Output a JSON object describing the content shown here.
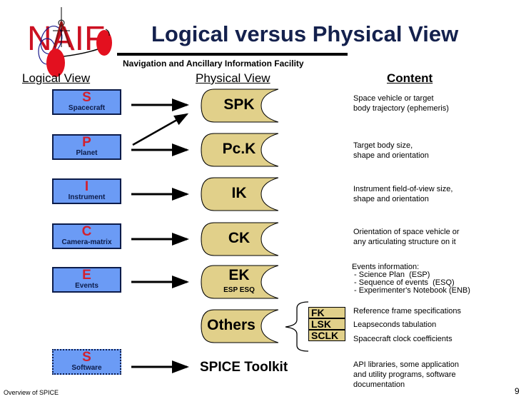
{
  "header": {
    "logo_text": "NAIF",
    "title": "Logical versus Physical View",
    "subtitle": "Navigation and Ancillary Information Facility"
  },
  "columns": {
    "logical": "Logical View",
    "physical": "Physical View",
    "content": "Content"
  },
  "logical_items": [
    {
      "letter": "S",
      "word": "Spacecraft"
    },
    {
      "letter": "P",
      "word": "Planet"
    },
    {
      "letter": "I",
      "word": "Instrument"
    },
    {
      "letter": "C",
      "word": "Camera-matrix"
    },
    {
      "letter": "E",
      "word": "Events"
    },
    {
      "letter": "S",
      "word": "Software"
    }
  ],
  "physical_items": [
    {
      "label": "SPK"
    },
    {
      "label": "Pc.K"
    },
    {
      "label": "IK"
    },
    {
      "label": "CK"
    },
    {
      "label": "EK",
      "sub": "ESP ESQ"
    },
    {
      "label": "Others"
    }
  ],
  "other_kernels": [
    "FK",
    "LSK",
    "SCLK"
  ],
  "toolkit_label": "SPICE Toolkit",
  "content": {
    "spk": [
      "Space vehicle or target",
      "body trajectory (ephemeris)"
    ],
    "pck": [
      "Target body size,",
      "shape and orientation"
    ],
    "ik": [
      "Instrument field-of-view size,",
      "shape and orientation"
    ],
    "ck": [
      "Orientation of space vehicle or",
      "any articulating structure on it"
    ],
    "ek": [
      "Events information:",
      " - Science Plan  (ESP)",
      " - Sequence of events  (ESQ)",
      " - Experimenter's Notebook (ENB)"
    ],
    "fk": "Reference frame specifications",
    "lsk": "Leapseconds tabulation",
    "sclk": "Spacecraft clock coefficients",
    "toolkit": [
      "API libraries, some application",
      "and utility programs, software",
      "documentation"
    ]
  },
  "footer": {
    "left": "Overview of SPICE",
    "page": "9"
  },
  "colors": {
    "title": "#14214d",
    "logical_box": "#6b9bf5",
    "letter_red": "#d2202e",
    "scroll_tan": "#e1d08a",
    "logo_red": "#cc1122"
  }
}
